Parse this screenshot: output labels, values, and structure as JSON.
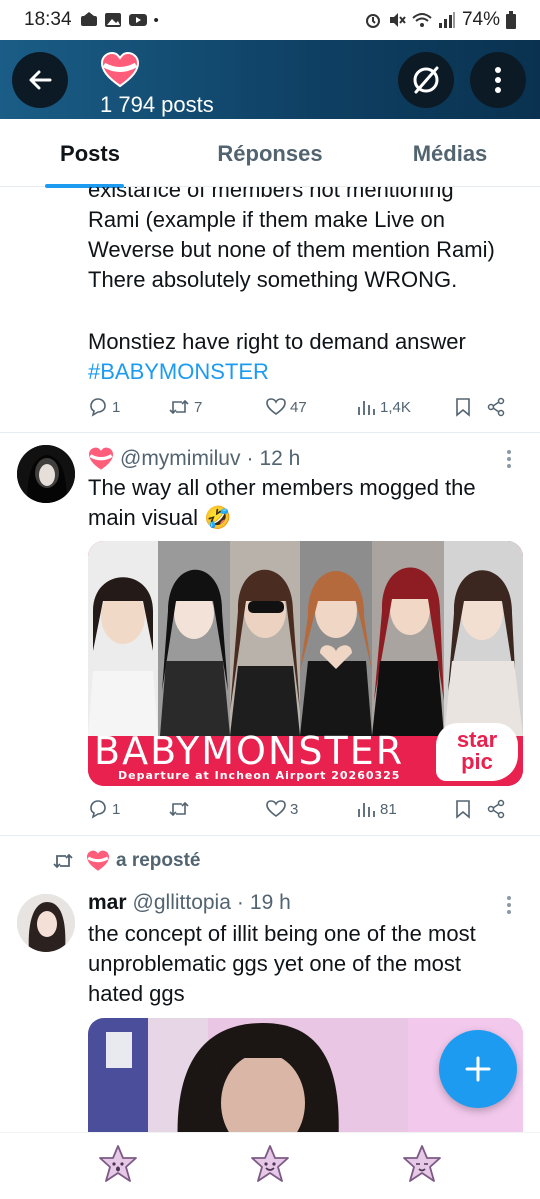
{
  "status": {
    "time": "18:34",
    "battery": "74%"
  },
  "header": {
    "posts_count": "1 794 posts"
  },
  "tabs": [
    {
      "label": "Posts",
      "active": true
    },
    {
      "label": "Réponses",
      "active": false
    },
    {
      "label": "Médias",
      "active": false
    }
  ],
  "post1": {
    "cut_line": "existance of members not mentioning",
    "lines": [
      "Rami (example if them make Live on",
      "Weverse but none of them mention Rami)",
      "There absolutely something WRONG."
    ],
    "line2": "Monstiez have right to demand answer",
    "hashtag": "#BABYMONSTER",
    "replies": "1",
    "reposts": "7",
    "likes": "47",
    "views": "1,4K"
  },
  "post2": {
    "handle": "@mymimiluv",
    "time": "12 h",
    "text1": "The way all other members mogged the",
    "text2": "main visual",
    "emoji": "🤣",
    "image": {
      "title": "BABYMONSTER",
      "subtitle": "Departure at Incheon Airport 20260325",
      "logo_top": "star",
      "logo_bottom": "pic"
    },
    "replies": "1",
    "reposts": "",
    "likes": "3",
    "views": "81"
  },
  "post3": {
    "repost_label": "a reposté",
    "name": "mar",
    "handle": "@gllittopia",
    "time": "19 h",
    "text": [
      "the concept of illit being one of the most",
      "unproblematic ggs yet one of the most",
      "hated ggs"
    ]
  },
  "colors": {
    "accent": "#1d9bf0",
    "header_bg": "#0e3f62",
    "image_banner": "#e8214f",
    "nav_star": "#d9b7dd"
  }
}
